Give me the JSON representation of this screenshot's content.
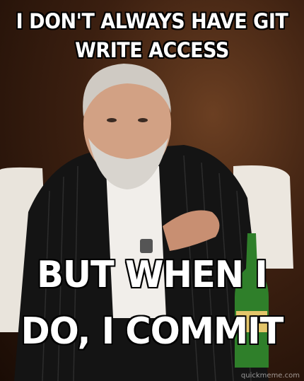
{
  "meme": {
    "top_text_line1": "I DON'T ALWAYS HAVE GIT",
    "top_text_line2": "WRITE ACCESS",
    "bottom_text_line1": "BUT WHEN I",
    "bottom_text_line2": "DO, I COMMIT",
    "watermark": "quickmeme.com"
  },
  "colors": {
    "caption_fill": "#ffffff",
    "caption_stroke": "#000000",
    "background": "#3b1f10"
  }
}
